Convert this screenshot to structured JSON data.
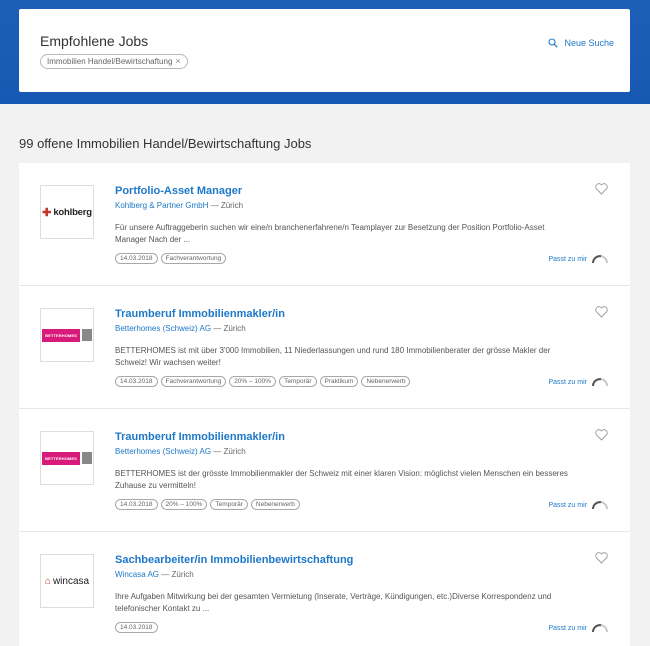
{
  "search": {
    "title": "Empfohlene Jobs",
    "filter_chip": "Immobilien Handel/Bewirtschaftung",
    "chip_close": "×",
    "new_search": "Neue Suche"
  },
  "results": {
    "count_text": "99 offene Immobilien Handel/Bewirtschaftung Jobs"
  },
  "jobs": [
    {
      "title": "Portfolio-Asset Manager",
      "company": "Kohlberg & Partner GmbH",
      "location": "Zürich",
      "separator": "—",
      "description": "Für unsere Auftraggeberin suchen wir eine/n branchenerfahrene/n Teamplayer zur Besetzung der Position Portfolio-Asset Manager Nach der ...",
      "tags": [
        "14.03.2018",
        "Fachverantwortung"
      ],
      "match_label": "Passt zu mir",
      "logo_text": "kohlberg"
    },
    {
      "title": "Traumberuf Immobilienmakler/in",
      "company": "Betterhomes (Schweiz) AG",
      "location": "Zürich",
      "separator": "—",
      "description": "BETTERHOMES ist mit über 3'000 Immobilien, 11 Niederlassungen und rund 180 Immobilienberater der grösse Makler der Schweiz! Wir wachsen weiter!",
      "tags": [
        "14.03.2018",
        "Fachverantwortung",
        "20% – 100%",
        "Temporär",
        "Praktikum",
        "Nebenerwerb"
      ],
      "match_label": "Passt zu mir",
      "logo_text": "BETTERHOMES"
    },
    {
      "title": "Traumberuf Immobilienmakler/in",
      "company": "Betterhomes (Schweiz) AG",
      "location": "Zürich",
      "separator": "—",
      "description": "BETTERHOMES ist der grösste Immobilienmakler der Schweiz mit einer klaren Vision: möglichst vielen Menschen ein besseres Zuhause zu vermitteln!",
      "tags": [
        "14.03.2018",
        "20% – 100%",
        "Temporär",
        "Nebenerwerb"
      ],
      "match_label": "Passt zu mir",
      "logo_text": "BETTERHOMES"
    },
    {
      "title": "Sachbearbeiter/in Immobilienbewirtschaftung",
      "company": "Wincasa AG",
      "location": "Zürich",
      "separator": "—",
      "description": "Ihre Aufgaben Mitwirkung bei der gesamten Vermietung (Inserate, Verträge, Kündigungen, etc.)Diverse Korrespondenz und telefonischer Kontakt zu ...",
      "tags": [
        "14.03.2018"
      ],
      "match_label": "Passt zu mir",
      "logo_text": "wincasa"
    }
  ],
  "colors": {
    "brand_blue": "#1758b3",
    "link_blue": "#1d78c8",
    "betterhomes_pink": "#d81b7a"
  }
}
